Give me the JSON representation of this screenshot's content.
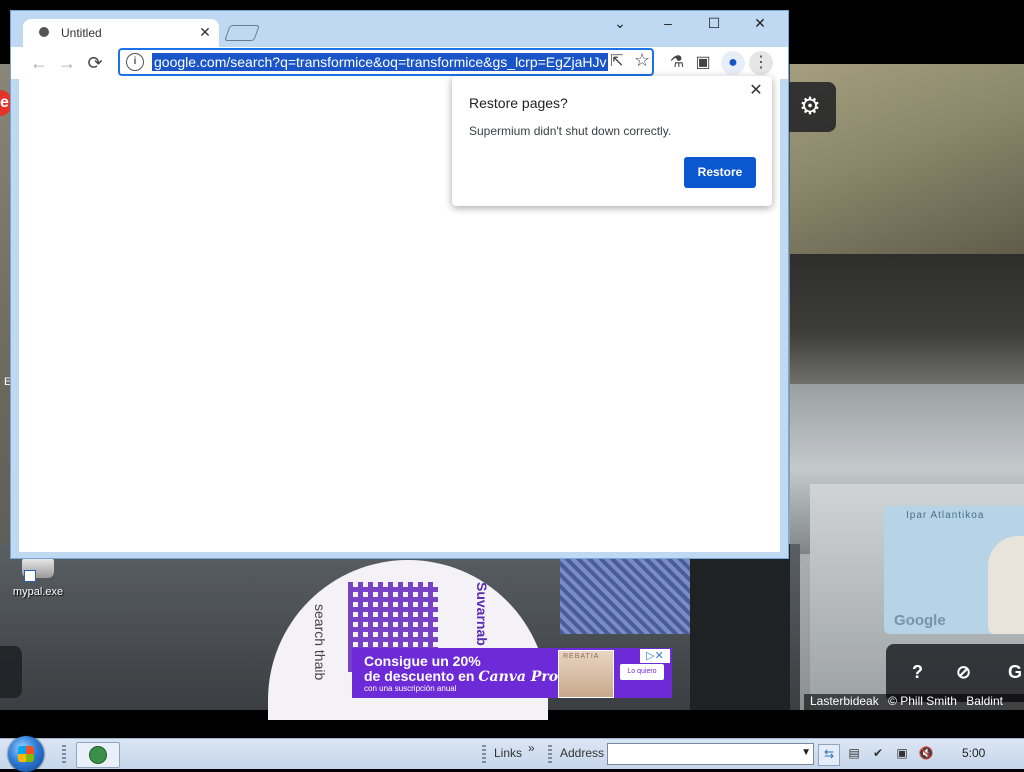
{
  "browser": {
    "tab_title": "Untitled",
    "url": "google.com/search?q=transformice&oq=transformice&gs_lcrp=EgZjaHJv",
    "window_controls": {
      "menu": "⌄",
      "minimize": "–",
      "maximize": "☐",
      "close": "✕"
    }
  },
  "restore_popup": {
    "title": "Restore pages?",
    "message": "Supermium didn't shut down correctly.",
    "button": "Restore",
    "close": "✕"
  },
  "desktop": {
    "icon_label": "mypal.exe"
  },
  "background": {
    "map_label": "Ipar Atlantikoa",
    "map_logo": "Google",
    "attribution": [
      "Lasterbideak",
      "© Phill Smith",
      "Baldint"
    ],
    "help_button": "?",
    "compass": "⊘",
    "gs_label": "G"
  },
  "ad": {
    "line1": "Consigue un 20%",
    "line2_prefix": "de descuento en ",
    "brand": "Canva Pro",
    "line3": "con una suscripción anual",
    "photo_label": "REBATIA",
    "cta": "Lo quiero"
  },
  "sign": {
    "text1": "Suvarnab",
    "text2": "search thaib"
  },
  "taskbar": {
    "links": "Links",
    "chevron": "»",
    "address_label": "Address",
    "address_value": "",
    "clock": "5:00"
  },
  "colors": {
    "accent": "#1a73e8",
    "button": "#0b57d0",
    "ad_purple": "#6d2bd8"
  }
}
